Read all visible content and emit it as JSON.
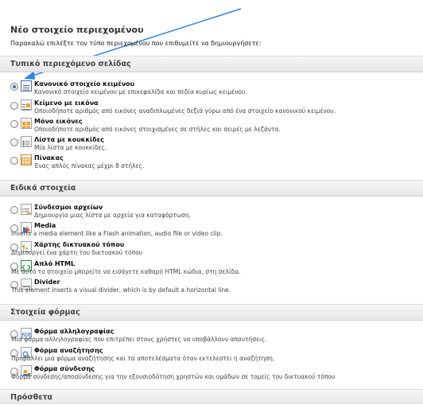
{
  "page": {
    "title": "Νέο στοιχείο περιεχομένου",
    "intro": "Παρακαλώ επιλέξτε τον τύπο περιεχομένου που επιθυμείτε να δημιουργήσετε:"
  },
  "sections": {
    "typical": {
      "header": "Τυπικό περιεχόμενο σελίδας",
      "items": [
        {
          "title": "Κανονικό στοιχείο κειμένου",
          "desc": "Κανονικό στοιχείο κειμένου με επικεφαλίδα και πεδία κυρίως κειμένου.",
          "icon": "text-icon"
        },
        {
          "title": "Κείμενο με εικόνα",
          "desc": "Οποιοδήποτε αριθμός από εικόνες αναδιπλωμένες δεξιά γύρω από ένα στοιχείο κανονικού κειμένου.",
          "icon": "text-image-icon"
        },
        {
          "title": "Μόνο εικόνες",
          "desc": "Οποιοδήποτε αριθμός από εικόνες στοιχισμένες σε στήλες και σειρές με λεζάντα.",
          "icon": "images-icon"
        },
        {
          "title": "Λίστα με κουκκίδες",
          "desc": "Μία λίστα με κουκκίδες.",
          "icon": "bullet-list-icon"
        },
        {
          "title": "Πίνακας",
          "desc": "Ένας απλός πίνακας μέχρι 8 στήλες.",
          "icon": "table-icon"
        }
      ]
    },
    "special": {
      "header": "Ειδικά στοιχεία",
      "items": [
        {
          "title": "Σύνδεσμοι αρχείων",
          "desc": "Δημιουργία μιας λίστα με αρχεία για καταφόρτωση.",
          "icon": "file-links-icon"
        },
        {
          "title": "Media",
          "desc": "Inserts a media element like a Flash animation, audio file or video clip.",
          "icon": "media-icon"
        },
        {
          "title": "Χάρτης δικτυακού τόπου",
          "desc": "Δημιουργεί ένα χάρτη του δικτυακού τόπου",
          "icon": "sitemap-icon"
        },
        {
          "title": "Απλό HTML",
          "desc": "Με αυτό το στοιχείο μπορείτε να εισάγετε καθαρό HTML κώδια, στη σελίδα.",
          "icon": "html-icon"
        },
        {
          "title": "Divider",
          "desc": "This element inserts a visual divider, which is by default a horizontal line.",
          "icon": "divider-icon"
        }
      ]
    },
    "forms": {
      "header": "Στοιχεία φόρμας",
      "items": [
        {
          "title": "Φόρμα αλληλογραφίας",
          "desc": "Μια φόρμα αλληλογραφίας που επιτρέπει στους χρήστες να υποβάλλουν απαντήσεις.",
          "icon": "mail-form-icon"
        },
        {
          "title": "Φόρμα αναζήτησης",
          "desc": "Προβάλλει μια φόρμα αναζήτησης και τα αποτελέσματα όταν εκτελεστει η αναζήτηση.",
          "icon": "search-form-icon"
        },
        {
          "title": "Φόρμα σύνδεσης",
          "desc": "Φόρμα σύνδεσης/αποσύνδεσης για την εξουσιοδότηση χρηστών και ομάδων σε τομείς του δικτυακού τόπου",
          "icon": "login-form-icon"
        }
      ]
    },
    "plugins": {
      "header": "Πρόσθετα"
    }
  },
  "colors": {
    "accent_arrow": "#2f86e8",
    "selected_radio": "#3a6db5"
  }
}
